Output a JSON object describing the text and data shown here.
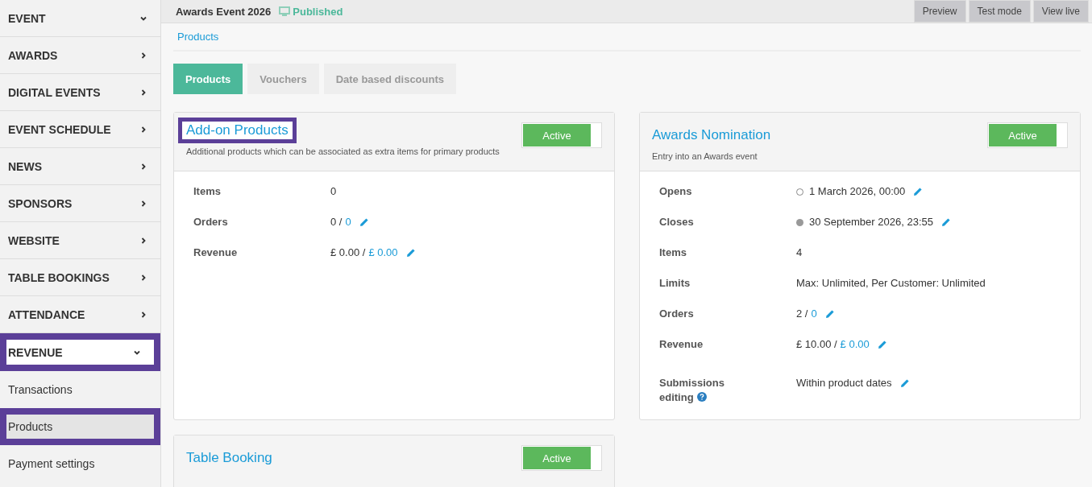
{
  "sidebar": {
    "items": [
      {
        "label": "EVENT",
        "expanded": true,
        "highlighted": false
      },
      {
        "label": "AWARDS",
        "expanded": false,
        "highlighted": false
      },
      {
        "label": "DIGITAL EVENTS",
        "expanded": false,
        "highlighted": false
      },
      {
        "label": "EVENT SCHEDULE",
        "expanded": false,
        "highlighted": false
      },
      {
        "label": "NEWS",
        "expanded": false,
        "highlighted": false
      },
      {
        "label": "SPONSORS",
        "expanded": false,
        "highlighted": false
      },
      {
        "label": "WEBSITE",
        "expanded": false,
        "highlighted": false
      },
      {
        "label": "TABLE BOOKINGS",
        "expanded": false,
        "highlighted": false
      },
      {
        "label": "ATTENDANCE",
        "expanded": false,
        "highlighted": false
      },
      {
        "label": "REVENUE",
        "expanded": true,
        "highlighted": true,
        "children": [
          {
            "label": "Transactions",
            "selected": false,
            "highlighted": false
          },
          {
            "label": "Products",
            "selected": true,
            "highlighted": true
          },
          {
            "label": "Payment settings",
            "selected": false,
            "highlighted": false
          }
        ]
      }
    ]
  },
  "header": {
    "title": "Awards Event 2026",
    "status": "Published",
    "buttons": [
      "Preview",
      "Test mode",
      "View live"
    ]
  },
  "breadcrumb": "Products",
  "tabs": [
    {
      "label": "Products",
      "selected": true
    },
    {
      "label": "Vouchers",
      "selected": false
    },
    {
      "label": "Date based discounts",
      "selected": false
    }
  ],
  "cards": [
    {
      "title": "Add-on Products",
      "highlighted": true,
      "description": "Additional products which can be associated as extra items for primary products",
      "toggle": {
        "label": "Active",
        "on": true
      },
      "rows": [
        {
          "label": "Items",
          "value": "0",
          "editable": false
        },
        {
          "label": "Orders",
          "value": "0 /",
          "link": "0",
          "editable": true
        },
        {
          "label": "Revenue",
          "value": "£ 0.00 /",
          "link": "£ 0.00",
          "editable": true,
          "tall": true
        }
      ]
    },
    {
      "title": "Awards Nomination",
      "highlighted": false,
      "description": "Entry into an Awards event",
      "toggle": {
        "label": "Active",
        "on": true
      },
      "rows": [
        {
          "label": "Opens",
          "dot_filled": false,
          "value": "1 March 2026, 00:00",
          "editable": true
        },
        {
          "label": "Closes",
          "dot_filled": true,
          "value": "30 September 2026, 23:55",
          "editable": true
        },
        {
          "label": "Items",
          "value": "4",
          "editable": false
        },
        {
          "label": "Limits",
          "value": "Max: Unlimited, Per Customer: Unlimited",
          "editable": false
        },
        {
          "label": "Orders",
          "value": "2 /",
          "link": "0",
          "editable": true
        },
        {
          "label": "Revenue",
          "value": "£ 10.00 /",
          "link": "£ 0.00",
          "editable": true,
          "tall": true
        },
        {
          "label": "Submissions editing",
          "help": true,
          "value": "Within product dates",
          "editable": true
        }
      ]
    },
    {
      "title": "Table Booking",
      "highlighted": false,
      "toggle": {
        "label": "Active",
        "on": true
      }
    }
  ]
}
